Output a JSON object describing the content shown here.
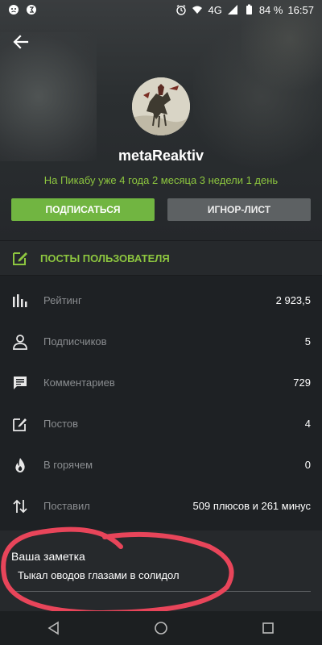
{
  "status_bar": {
    "network": "4G",
    "battery": "84 %",
    "time": "16:57"
  },
  "profile": {
    "username": "metaReaktiv",
    "tenure": "На Пикабу уже 4 года 2 месяца 3 недели 1 день",
    "subscribe_label": "ПОДПИСАТЬСЯ",
    "ignore_label": "ИГНОР-ЛИСТ"
  },
  "posts_link": {
    "label": "ПОСТЫ ПОЛЬЗОВАТЕЛЯ"
  },
  "stats": [
    {
      "icon": "rating-bars-icon",
      "label": "Рейтинг",
      "value": "2 923,5"
    },
    {
      "icon": "person-icon",
      "label": "Подписчиков",
      "value": "5"
    },
    {
      "icon": "comment-icon",
      "label": "Комментариев",
      "value": "729"
    },
    {
      "icon": "edit-icon",
      "label": "Постов",
      "value": "4"
    },
    {
      "icon": "flame-icon",
      "label": "В горячем",
      "value": "0"
    },
    {
      "icon": "up-down-arrows-icon",
      "label": "Поставил",
      "value": "509 плюсов и 261 минус"
    }
  ],
  "note": {
    "title": "Ваша заметка",
    "text": "Тыкал оводов глазами в солидол"
  },
  "colors": {
    "accent_green": "#8dc63f",
    "subscribe_button": "#71b541",
    "ignore_button": "#5d6163",
    "annotation_red": "#e8455a"
  }
}
